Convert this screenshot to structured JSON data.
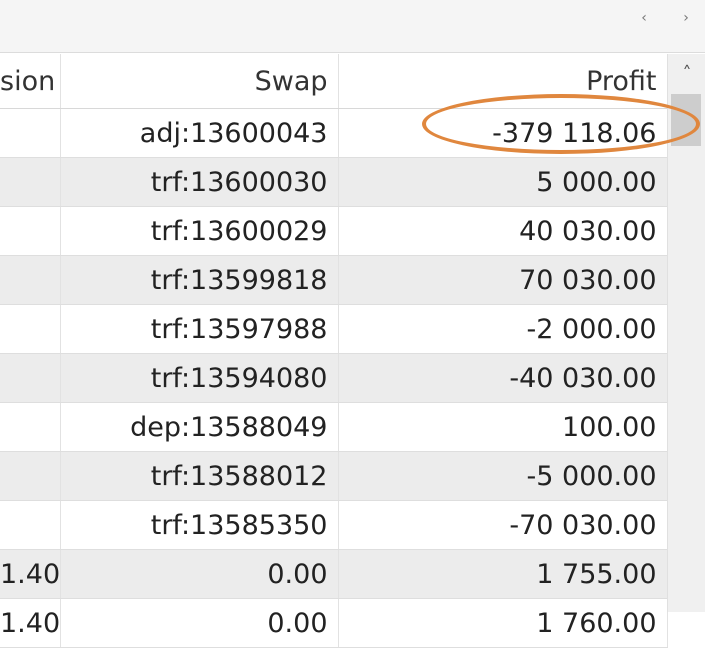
{
  "nav": {
    "prev_icon": "chevron-left-icon",
    "next_icon": "chevron-right-icon"
  },
  "columns": {
    "commission": "sion",
    "swap": "Swap",
    "profit": "Profit"
  },
  "rows": [
    {
      "commission": "",
      "swap": "adj:13600043",
      "profit": "-379 118.06"
    },
    {
      "commission": "",
      "swap": "trf:13600030",
      "profit": "5 000.00"
    },
    {
      "commission": "",
      "swap": "trf:13600029",
      "profit": "40 030.00"
    },
    {
      "commission": "",
      "swap": "trf:13599818",
      "profit": "70 030.00"
    },
    {
      "commission": "",
      "swap": "trf:13597988",
      "profit": "-2 000.00"
    },
    {
      "commission": "",
      "swap": "trf:13594080",
      "profit": "-40 030.00"
    },
    {
      "commission": "",
      "swap": "dep:13588049",
      "profit": "100.00"
    },
    {
      "commission": "",
      "swap": "trf:13588012",
      "profit": "-5 000.00"
    },
    {
      "commission": "",
      "swap": "trf:13585350",
      "profit": "-70 030.00"
    },
    {
      "commission": "1.40",
      "swap": "0.00",
      "profit": "1 755.00"
    },
    {
      "commission": "1.40",
      "swap": "0.00",
      "profit": "1 760.00"
    }
  ],
  "scrollbar": {
    "up_icon": "chevron-up-icon"
  },
  "colors": {
    "highlight": "#e0873e",
    "row_alt": "#ececec"
  }
}
